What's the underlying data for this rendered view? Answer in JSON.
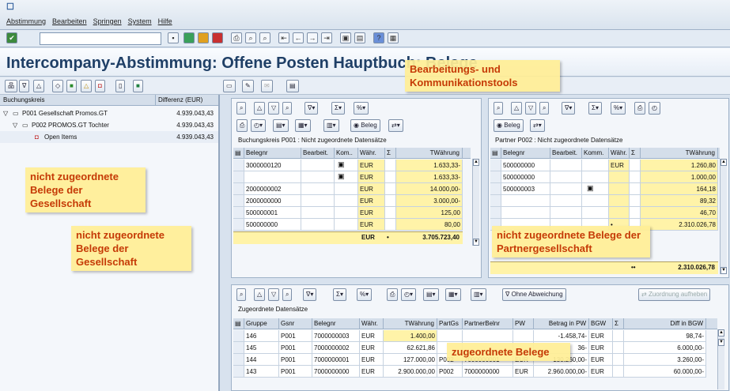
{
  "menu": {
    "items": [
      "Abstimmung",
      "Bearbeiten",
      "Springen",
      "System",
      "Hilfe"
    ]
  },
  "title": "Intercompany-Abstimmung: Offene Posten Hauptbuch: Belege",
  "tree": {
    "col1": "Buchungskreis",
    "col2": "Differenz (EUR)",
    "rows": [
      {
        "label": "P001 Gesellschaft Promos.GT",
        "value": "4.939.043,43"
      },
      {
        "label": "P002 PROMOS.GT Tochter",
        "value": "4.939.043,43"
      },
      {
        "label": "Open Items",
        "value": "4.939.043,43"
      }
    ]
  },
  "left_panel": {
    "beleg_btn": "Beleg",
    "heading": "Buchungskreis P001 : Nicht zugeordnete Datensätze",
    "headers": [
      "Belegnr",
      "Bearbeit.",
      "Kom..",
      "Währ.",
      "Σ",
      "TWährung"
    ],
    "rows": [
      [
        "3000000120",
        "",
        "",
        "EUR",
        "1.633,33-"
      ],
      [
        "",
        "",
        "",
        "EUR",
        "1.633,33-"
      ],
      [
        "2000000002",
        "",
        "",
        "EUR",
        "14.000,00-"
      ],
      [
        "2000000000",
        "",
        "",
        "EUR",
        "3.000,00-"
      ],
      [
        "500000001",
        "",
        "",
        "EUR",
        "125,00"
      ],
      [
        "500000000",
        "",
        "",
        "EUR",
        "80,00"
      ]
    ],
    "total_cur": "EUR",
    "total_dot": "•",
    "total": "3.705.723,40"
  },
  "right_panel": {
    "beleg_btn": "Beleg",
    "heading": "Partner P002 : Nicht zugeordnete Datensätze",
    "headers": [
      "Belegnr",
      "Bearbeit.",
      "Komm.",
      "Währ.",
      "Σ",
      "TWährung"
    ],
    "rows": [
      [
        "500000000",
        "",
        "",
        "EUR",
        "1.260,80"
      ],
      [
        "500000000",
        "",
        "",
        "",
        "1.000,00"
      ],
      [
        "500000003",
        "",
        "",
        "",
        "164,18"
      ],
      [
        "",
        "",
        "",
        "",
        "89,32"
      ],
      [
        "",
        "",
        "",
        "",
        "46,70"
      ],
      [
        "",
        "",
        "",
        "•",
        "2.310.026,78"
      ]
    ],
    "total_dot": "••",
    "total": "2.310.026,78"
  },
  "bottom_panel": {
    "ohne_btn": "Ohne Abweichung",
    "zuordnung_btn": "Zuordnung aufheben",
    "heading": "Zugeordnete Datensätze",
    "headers": [
      "Gruppe",
      "Gsnr",
      "Belegnr",
      "Währ.",
      "TWährung",
      "PartGs",
      "PartnerBelnr",
      "PW",
      "Betrag in PW",
      "BGW",
      "Σ",
      "Diff in BGW"
    ],
    "rows": [
      [
        "146",
        "P001",
        "7000000003",
        "EUR",
        "1.400,00",
        "",
        "",
        "",
        "-1.458,74-",
        "EUR",
        "",
        "98,74-"
      ],
      [
        "145",
        "P001",
        "7000000002",
        "EUR",
        "62.621,86",
        "",
        "",
        "",
        "36-",
        "EUR",
        "",
        "6.000,00-"
      ],
      [
        "144",
        "P001",
        "7000000001",
        "EUR",
        "127.000,00",
        "P002",
        "7000000001",
        "EUR",
        "130.260,00-",
        "EUR",
        "",
        "3.260,00-"
      ],
      [
        "143",
        "P001",
        "7000000000",
        "EUR",
        "2.900.000,00",
        "P002",
        "7000000000",
        "EUR",
        "2.960.000,00-",
        "EUR",
        "",
        "60.000,00-"
      ]
    ]
  },
  "callouts": {
    "tools": "Bearbeitungs- und Kommunikationstools",
    "left1": "nicht zugeordnete Belege der Gesellschaft",
    "left2": "nicht zugeordnete Belege der Gesellschaft",
    "right": "nicht zugeordnete Belege der Partnergesellschaft",
    "bottom": "zugeordnete Belege"
  },
  "colors": {
    "accent": "#c53a06",
    "highlight": "#fff3a8"
  }
}
